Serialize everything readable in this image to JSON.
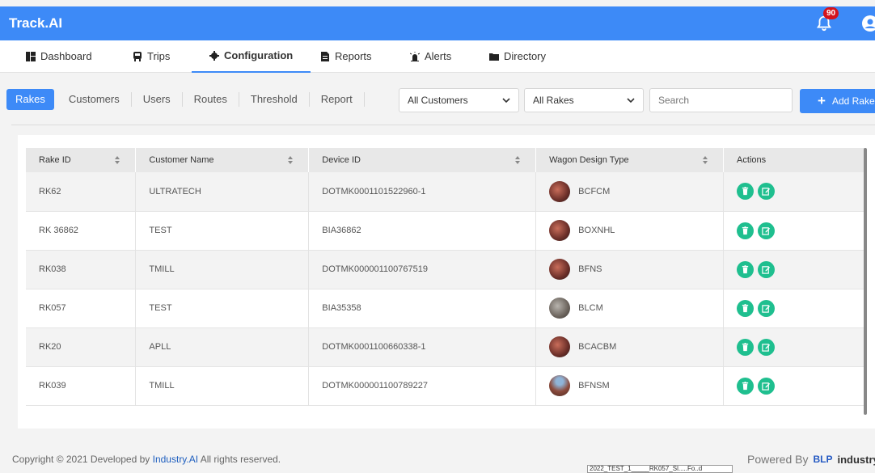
{
  "app": {
    "brand": "Track.AI",
    "notifications": "90"
  },
  "nav": [
    {
      "label": "Dashboard",
      "icon": "dashboard-icon"
    },
    {
      "label": "Trips",
      "icon": "train-icon"
    },
    {
      "label": "Configuration",
      "icon": "gear-icon",
      "active": true
    },
    {
      "label": "Reports",
      "icon": "document-icon"
    },
    {
      "label": "Alerts",
      "icon": "alarm-icon"
    },
    {
      "label": "Directory",
      "icon": "folder-icon"
    }
  ],
  "subtabs": [
    "Rakes",
    "Customers",
    "Users",
    "Routes",
    "Threshold",
    "Report"
  ],
  "filters": {
    "customer": "All Customers",
    "rake": "All Rakes",
    "search_placeholder": "Search",
    "add_label": "Add Rake"
  },
  "table": {
    "headers": [
      "Rake ID",
      "Customer Name",
      "Device ID",
      "Wagon Design Type",
      "Actions"
    ],
    "rows": [
      {
        "rake_id": "RK62",
        "customer": "ULTRATECH",
        "device": "DOTMK0001101522960-1",
        "wagon": "BCFCM",
        "img": "red"
      },
      {
        "rake_id": "RK 36862",
        "customer": "TEST",
        "device": "BIA36862",
        "wagon": "BOXNHL",
        "img": "red"
      },
      {
        "rake_id": "RK038",
        "customer": "TMILL",
        "device": "DOTMK000001100767519",
        "wagon": "BFNS",
        "img": "red"
      },
      {
        "rake_id": "RK057",
        "customer": "TEST",
        "device": "BIA35358",
        "wagon": "BLCM",
        "img": "grey"
      },
      {
        "rake_id": "RK20",
        "customer": "APLL",
        "device": "DOTMK0001100660338-1",
        "wagon": "BCACBM",
        "img": "red"
      },
      {
        "rake_id": "RK039",
        "customer": "TMILL",
        "device": "DOTMK000001100789227",
        "wagon": "BFNSM",
        "img": "blue"
      }
    ]
  },
  "footer": {
    "copyright_prefix": "Copyright © 2021 Developed by ",
    "company": "Industry.AI",
    "copyright_suffix": " All rights reserved.",
    "powered_by": "Powered By",
    "blp": "BLP",
    "industry": "industry",
    "industry_slash": "/"
  },
  "tooltip": "2022_TEST_1_____RK057_Sl.....Fo..d"
}
